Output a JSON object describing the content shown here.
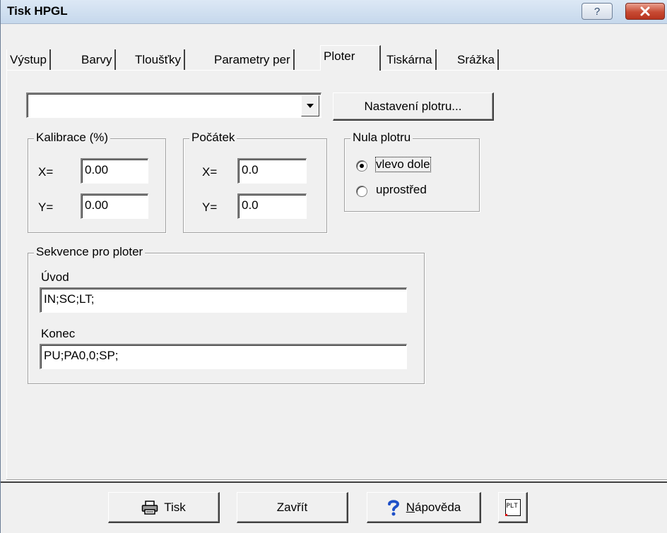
{
  "window": {
    "title": "Tisk HPGL",
    "help_glyph": "?",
    "close_icon": "close-x-icon"
  },
  "tabs": [
    {
      "label": "Výstup"
    },
    {
      "label": "Barvy"
    },
    {
      "label": "Tloušťky"
    },
    {
      "label": "Parametry per"
    },
    {
      "label": "Ploter",
      "active": true
    },
    {
      "label": "Tiskárna"
    },
    {
      "label": "Srážka"
    }
  ],
  "plotter": {
    "selected": "",
    "setup_button": "Nastavení plotru..."
  },
  "calibration": {
    "title": "Kalibrace (%)",
    "x_label": "X=",
    "x_value": "0.00",
    "y_label": "Y=",
    "y_value": "0.00"
  },
  "origin": {
    "title": "Počátek",
    "x_label": "X=",
    "x_value": "0.0",
    "y_label": "Y=",
    "y_value": "0.0"
  },
  "zero": {
    "title": "Nula plotru",
    "options": [
      {
        "label": "vlevo dole",
        "selected": true
      },
      {
        "label": "uprostřed",
        "selected": false
      }
    ]
  },
  "sequence": {
    "title": "Sekvence pro ploter",
    "intro_label": "Úvod",
    "intro_value": "IN;SC;LT;",
    "end_label": "Konec",
    "end_value": "PU;PA0,0;SP;"
  },
  "footer": {
    "print_label": "Tisk",
    "close_label": "Zavřít",
    "help_label_first": "N",
    "help_label_rest": "ápověda",
    "plt_icon_text": "PLT",
    "icons": [
      "printer-icon",
      "help-question-icon",
      "plt-file-icon"
    ]
  },
  "colors": {
    "face": "#f0f0f0",
    "close_red": "#c74a33",
    "help_blue": "#1e50c8"
  }
}
